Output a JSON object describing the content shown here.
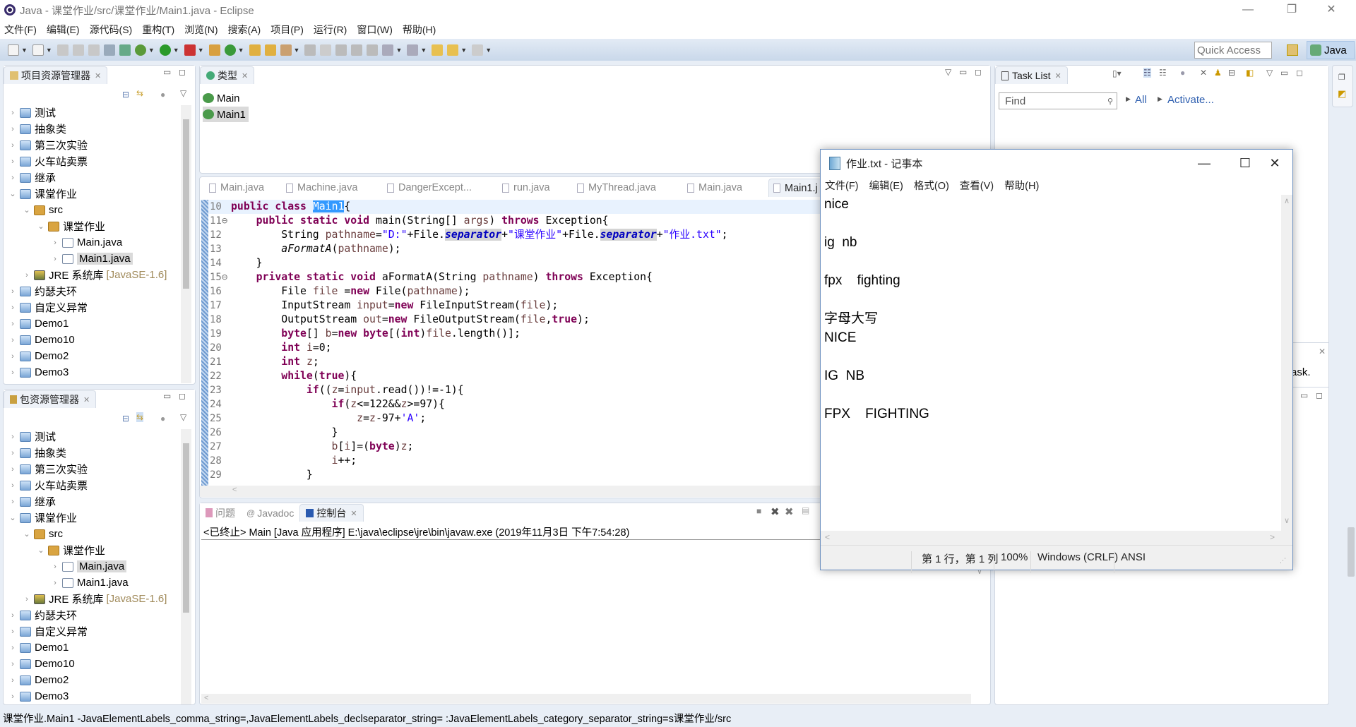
{
  "window": {
    "title": "Java  -  课堂作业/src/课堂作业/Main1.java  -  Eclipse",
    "minimize": "—",
    "restore": "❐",
    "close": "✕"
  },
  "menu": [
    "文件(F)",
    "编辑(E)",
    "源代码(S)",
    "重构(T)",
    "浏览(N)",
    "搜索(A)",
    "项目(P)",
    "运行(R)",
    "窗口(W)",
    "帮助(H)"
  ],
  "toolbar": {
    "quick_access": "Quick Access",
    "perspective": "Java"
  },
  "project_explorer": {
    "title": "项目资源管理器",
    "items": [
      {
        "label": "测试",
        "depth": 0,
        "state": "collapsed",
        "icon": "project"
      },
      {
        "label": "抽象类",
        "depth": 0,
        "state": "collapsed",
        "icon": "project"
      },
      {
        "label": "第三次实验",
        "depth": 0,
        "state": "collapsed",
        "icon": "project"
      },
      {
        "label": "火车站卖票",
        "depth": 0,
        "state": "collapsed",
        "icon": "project"
      },
      {
        "label": "继承",
        "depth": 0,
        "state": "collapsed",
        "icon": "project"
      },
      {
        "label": "课堂作业",
        "depth": 0,
        "state": "expanded",
        "icon": "project"
      },
      {
        "label": "src",
        "depth": 1,
        "state": "expanded",
        "icon": "package"
      },
      {
        "label": "课堂作业",
        "depth": 2,
        "state": "expanded",
        "icon": "package"
      },
      {
        "label": "Main.java",
        "depth": 3,
        "state": "collapsed",
        "icon": "java"
      },
      {
        "label": "Main1.java",
        "depth": 3,
        "state": "collapsed",
        "icon": "java",
        "selected": true
      },
      {
        "label": "JRE 系统库",
        "depth": 1,
        "state": "collapsed",
        "icon": "library",
        "decoration": "[JavaSE-1.6]"
      },
      {
        "label": "约瑟夫环",
        "depth": 0,
        "state": "collapsed",
        "icon": "project"
      },
      {
        "label": "自定义异常",
        "depth": 0,
        "state": "collapsed",
        "icon": "project"
      },
      {
        "label": "Demo1",
        "depth": 0,
        "state": "collapsed",
        "icon": "project"
      },
      {
        "label": "Demo10",
        "depth": 0,
        "state": "collapsed",
        "icon": "project"
      },
      {
        "label": "Demo2",
        "depth": 0,
        "state": "collapsed",
        "icon": "project"
      },
      {
        "label": "Demo3",
        "depth": 0,
        "state": "collapsed",
        "icon": "project"
      }
    ]
  },
  "package_explorer": {
    "title": "包资源管理器",
    "items": [
      {
        "label": "测试",
        "depth": 0,
        "state": "collapsed",
        "icon": "project"
      },
      {
        "label": "抽象类",
        "depth": 0,
        "state": "collapsed",
        "icon": "project"
      },
      {
        "label": "第三次实验",
        "depth": 0,
        "state": "collapsed",
        "icon": "project"
      },
      {
        "label": "火车站卖票",
        "depth": 0,
        "state": "collapsed",
        "icon": "project"
      },
      {
        "label": "继承",
        "depth": 0,
        "state": "collapsed",
        "icon": "project"
      },
      {
        "label": "课堂作业",
        "depth": 0,
        "state": "expanded",
        "icon": "project"
      },
      {
        "label": "src",
        "depth": 1,
        "state": "expanded",
        "icon": "package"
      },
      {
        "label": "课堂作业",
        "depth": 2,
        "state": "expanded",
        "icon": "package"
      },
      {
        "label": "Main.java",
        "depth": 3,
        "state": "collapsed",
        "icon": "java",
        "selected": true
      },
      {
        "label": "Main1.java",
        "depth": 3,
        "state": "collapsed",
        "icon": "java"
      },
      {
        "label": "JRE 系统库",
        "depth": 1,
        "state": "collapsed",
        "icon": "library",
        "decoration": "[JavaSE-1.6]"
      },
      {
        "label": "约瑟夫环",
        "depth": 0,
        "state": "collapsed",
        "icon": "project"
      },
      {
        "label": "自定义异常",
        "depth": 0,
        "state": "collapsed",
        "icon": "project"
      },
      {
        "label": "Demo1",
        "depth": 0,
        "state": "collapsed",
        "icon": "project"
      },
      {
        "label": "Demo10",
        "depth": 0,
        "state": "collapsed",
        "icon": "project"
      },
      {
        "label": "Demo2",
        "depth": 0,
        "state": "collapsed",
        "icon": "project"
      },
      {
        "label": "Demo3",
        "depth": 0,
        "state": "collapsed",
        "icon": "project"
      }
    ]
  },
  "type_hierarchy": {
    "title": "类型",
    "items": [
      "Main",
      "Main1"
    ],
    "selected": "Main1"
  },
  "editor": {
    "tabs": [
      "Main.java",
      "Machine.java",
      "DangerExcept...",
      "run.java",
      "MyThread.java",
      "Main.java",
      "Main1.j"
    ],
    "active_tab": 6,
    "lines": [
      {
        "n": "10",
        "t": [
          [
            "public",
            "kw"
          ],
          [
            " ",
            ""
          ],
          [
            "class",
            "kw"
          ],
          [
            " ",
            ""
          ],
          [
            "Main1",
            "selm"
          ],
          [
            "{",
            ""
          ]
        ]
      },
      {
        "n": "11⊖",
        "t": [
          [
            "    ",
            ""
          ],
          [
            "public",
            "kw"
          ],
          [
            " ",
            ""
          ],
          [
            "static",
            "kw"
          ],
          [
            " ",
            ""
          ],
          [
            "void",
            "kw"
          ],
          [
            " main(String[] ",
            ""
          ],
          [
            "args",
            "var"
          ],
          [
            ") ",
            ""
          ],
          [
            "throws",
            "kw"
          ],
          [
            " Exception{",
            ""
          ]
        ]
      },
      {
        "n": "12",
        "t": [
          [
            "        String ",
            ""
          ],
          [
            "pathname",
            "var"
          ],
          [
            "=",
            ""
          ],
          [
            "\"D:\"",
            "str"
          ],
          [
            "+File.",
            ""
          ],
          [
            "separator",
            "fld"
          ],
          [
            "+",
            ""
          ],
          [
            "\"课堂作业\"",
            "str"
          ],
          [
            "+File.",
            ""
          ],
          [
            "separator",
            "fld"
          ],
          [
            "+",
            ""
          ],
          [
            "\"作业.txt\"",
            "str"
          ],
          [
            ";",
            ""
          ]
        ]
      },
      {
        "n": "13",
        "t": [
          [
            "        ",
            ""
          ],
          [
            "aFormatA",
            "ital"
          ],
          [
            "(",
            ""
          ],
          [
            "pathname",
            "var"
          ],
          [
            ");",
            ""
          ]
        ]
      },
      {
        "n": "14",
        "t": [
          [
            "    }",
            ""
          ]
        ]
      },
      {
        "n": "15⊖",
        "t": [
          [
            "    ",
            ""
          ],
          [
            "private",
            "kw"
          ],
          [
            " ",
            ""
          ],
          [
            "static",
            "kw"
          ],
          [
            " ",
            ""
          ],
          [
            "void",
            "kw"
          ],
          [
            " aFormatA(String ",
            ""
          ],
          [
            "pathname",
            "var"
          ],
          [
            ") ",
            ""
          ],
          [
            "throws",
            "kw"
          ],
          [
            " Exception{",
            ""
          ]
        ]
      },
      {
        "n": "16",
        "t": [
          [
            "        File ",
            ""
          ],
          [
            "file",
            "var"
          ],
          [
            " =",
            ""
          ],
          [
            "new",
            "kw"
          ],
          [
            " File(",
            ""
          ],
          [
            "pathname",
            "var"
          ],
          [
            ");",
            ""
          ]
        ]
      },
      {
        "n": "17",
        "t": [
          [
            "        InputStream ",
            ""
          ],
          [
            "input",
            "var"
          ],
          [
            "=",
            ""
          ],
          [
            "new",
            "kw"
          ],
          [
            " FileInputStream(",
            ""
          ],
          [
            "file",
            "var"
          ],
          [
            ");",
            ""
          ]
        ]
      },
      {
        "n": "18",
        "t": [
          [
            "        OutputStream ",
            ""
          ],
          [
            "out",
            "var"
          ],
          [
            "=",
            ""
          ],
          [
            "new",
            "kw"
          ],
          [
            " FileOutputStream(",
            ""
          ],
          [
            "file",
            "var"
          ],
          [
            ",",
            ""
          ],
          [
            "true",
            "kw"
          ],
          [
            ");",
            ""
          ]
        ]
      },
      {
        "n": "19",
        "t": [
          [
            "        ",
            ""
          ],
          [
            "byte",
            "kw"
          ],
          [
            "[] ",
            ""
          ],
          [
            "b",
            "var"
          ],
          [
            "=",
            ""
          ],
          [
            "new",
            "kw"
          ],
          [
            " ",
            ""
          ],
          [
            "byte",
            "kw"
          ],
          [
            "[(",
            ""
          ],
          [
            "int",
            "kw"
          ],
          [
            ")",
            ""
          ],
          [
            "file",
            "var"
          ],
          [
            ".length()];",
            ""
          ]
        ]
      },
      {
        "n": "20",
        "t": [
          [
            "        ",
            ""
          ],
          [
            "int",
            "kw"
          ],
          [
            " ",
            ""
          ],
          [
            "i",
            "var"
          ],
          [
            "=0;",
            ""
          ]
        ]
      },
      {
        "n": "21",
        "t": [
          [
            "        ",
            ""
          ],
          [
            "int",
            "kw"
          ],
          [
            " ",
            ""
          ],
          [
            "z",
            "var"
          ],
          [
            ";",
            ""
          ]
        ]
      },
      {
        "n": "22",
        "t": [
          [
            "        ",
            ""
          ],
          [
            "while",
            "kw"
          ],
          [
            "(",
            ""
          ],
          [
            "true",
            "kw"
          ],
          [
            "){",
            ""
          ]
        ]
      },
      {
        "n": "23",
        "t": [
          [
            "            ",
            ""
          ],
          [
            "if",
            "kw"
          ],
          [
            "((",
            ""
          ],
          [
            "z",
            "var"
          ],
          [
            "=",
            ""
          ],
          [
            "input",
            "var"
          ],
          [
            ".read())!=-1){",
            ""
          ]
        ]
      },
      {
        "n": "24",
        "t": [
          [
            "                ",
            ""
          ],
          [
            "if",
            "kw"
          ],
          [
            "(",
            ""
          ],
          [
            "z",
            "var"
          ],
          [
            "<=122&&",
            ""
          ],
          [
            "z",
            "var"
          ],
          [
            ">=97){",
            ""
          ]
        ]
      },
      {
        "n": "25",
        "t": [
          [
            "                    ",
            ""
          ],
          [
            "z",
            "var"
          ],
          [
            "=",
            ""
          ],
          [
            "z",
            "var"
          ],
          [
            "-97+",
            ""
          ],
          [
            "'A'",
            "str"
          ],
          [
            ";",
            ""
          ]
        ]
      },
      {
        "n": "26",
        "t": [
          [
            "                }",
            ""
          ]
        ]
      },
      {
        "n": "27",
        "t": [
          [
            "                ",
            ""
          ],
          [
            "b",
            "var"
          ],
          [
            "[",
            ""
          ],
          [
            "i",
            "var"
          ],
          [
            "]=(",
            ""
          ],
          [
            "byte",
            "kw"
          ],
          [
            ")",
            ""
          ],
          [
            "z",
            "var"
          ],
          [
            ";",
            ""
          ]
        ]
      },
      {
        "n": "28",
        "t": [
          [
            "                ",
            ""
          ],
          [
            "i",
            "var"
          ],
          [
            "++;",
            ""
          ]
        ]
      },
      {
        "n": "29",
        "t": [
          [
            "            }",
            ""
          ]
        ]
      }
    ]
  },
  "console": {
    "tabs": [
      "问题",
      "Javadoc",
      "控制台"
    ],
    "active_tab": 2,
    "header": "<已终止> Main [Java 应用程序] E:\\java\\eclipse\\jre\\bin\\javaw.exe  (2019年11月3日 下午7:54:28)"
  },
  "task_list": {
    "title": "Task List",
    "find_placeholder": "Find",
    "all_link": "All",
    "activate_link": "Activate...",
    "partial_text": "ask."
  },
  "notepad": {
    "title": "作业.txt - 记事本",
    "menu": [
      "文件(F)",
      "编辑(E)",
      "格式(O)",
      "查看(V)",
      "帮助(H)"
    ],
    "content": "nice\n\nig  nb\n\nfpx    fighting\n\n字母大写\nNICE\n\nIG  NB\n\nFPX    FIGHTING",
    "status": {
      "position": "第 1 行，第 1 列",
      "zoom": "100%",
      "line_ending": "Windows (CRLF)",
      "encoding": "ANSI"
    }
  },
  "status_bar": {
    "text": "课堂作业.Main1 -JavaElementLabels_comma_string=,JavaElementLabels_declseparator_string= :JavaElementLabels_category_separator_string=s课堂作业/src"
  }
}
